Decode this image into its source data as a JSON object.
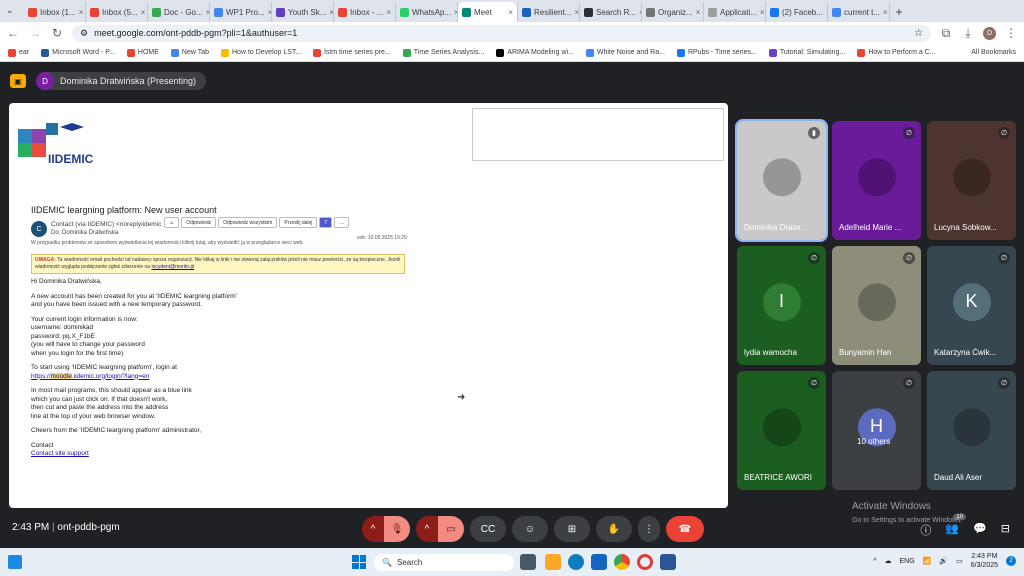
{
  "tabs": [
    {
      "label": "Inbox (1...",
      "color": "#ea4335"
    },
    {
      "label": "Inbox (5...",
      "color": "#ea4335"
    },
    {
      "label": "Doc - Go...",
      "color": "#34a853"
    },
    {
      "label": "WP1 Pro...",
      "color": "#4285f4"
    },
    {
      "label": "Youth Sk...",
      "color": "#5f3dc4"
    },
    {
      "label": "Inbox - ...",
      "color": "#ea4335"
    },
    {
      "label": "WhatsAp...",
      "color": "#25d366"
    },
    {
      "label": "Meet",
      "color": "#00897b",
      "active": true
    },
    {
      "label": "Resilient...",
      "color": "#1565c0"
    },
    {
      "label": "Search R...",
      "color": "#263238"
    },
    {
      "label": "Organiz...",
      "color": "#757575"
    },
    {
      "label": "Applicati...",
      "color": "#9e9e9e"
    },
    {
      "label": "(2) Faceb...",
      "color": "#1877f2"
    },
    {
      "label": "current t...",
      "color": "#4285f4"
    }
  ],
  "omnibox": {
    "url": "meet.google.com/ont-pddb-pgm?pli=1&authuser=1"
  },
  "bookmarks": [
    {
      "label": "ear",
      "color": "#ea4335"
    },
    {
      "label": "Microsoft Word - P...",
      "color": "#2b579a"
    },
    {
      "label": "HOME",
      "color": "#ea4335"
    },
    {
      "label": "New Tab",
      "color": "#4285f4"
    },
    {
      "label": "How to Develop LST...",
      "color": "#fbbc04"
    },
    {
      "label": "lstm time series pre...",
      "color": "#ea4335"
    },
    {
      "label": "Time Series Analysis...",
      "color": "#34a853"
    },
    {
      "label": "ARIMA Modeling wi...",
      "color": "#000000"
    },
    {
      "label": "White Noise and Ra...",
      "color": "#4285f4"
    },
    {
      "label": "RPubs - Time series...",
      "color": "#1877f2"
    },
    {
      "label": "Tutorial: Simulating...",
      "color": "#6f42c1"
    },
    {
      "label": "How to Perform a C...",
      "color": "#ea4335"
    }
  ],
  "all_bookmarks": "All Bookmarks",
  "presenter": {
    "initial": "D",
    "label": "Dominika Dratwińska (Presenting)"
  },
  "email": {
    "logo_text": "IIDEMIC",
    "subject": "IIDEMIC leargning platform: New user account",
    "sender": "Contact  (via IIDEMIC) <noreplyiidemic",
    "to": "Do:   Dominika Dratwińska",
    "date": "sob. 10.05.2025 19:29",
    "display_note": "W przypadku problemów ze sposobem wyświetlania tej wiadomości kliknij tutaj, aby wyświetlić ją w przeglądarce sieci web.",
    "actions": [
      "Odpowiedz",
      "Odpowiedz wszystkim",
      "Prześlij dalej"
    ],
    "warning_label": "UWAGA:",
    "warning": "Ta wiadomość email pochodzi od nadawcy spoza organizacji. Nie klikaj w linki i nie otwieraj załączników jeżeli nie masz pewności, że są bezpieczne. Jeżeli wiadomość wygląda podejrzanie zgłoś zdarzenie na",
    "warning_link": "incydent@merito.pl",
    "greeting": "Hi Dominika Dratwińska,",
    "p1": [
      "A new account has been created for you at 'IIDEMIC leargning platform'",
      "and you have been issued with a new temporary password."
    ],
    "p2": [
      "Your current login information is now:",
      "username: dominikad",
      "password: pq.X_F1bE",
      "(you will have to change your password",
      "when you login for the first time)"
    ],
    "p3": "To start using 'IIDEMIC leargning platform', login at",
    "link_pre": "https://",
    "link_hl": "moodle",
    "link_post": ".iidemic.org/login/?lang=en",
    "p4": [
      "In most mail programs, this should appear as a blue link",
      "which you can just click on. If that doesn't work,",
      "then cut and paste the address into the address",
      "line at the top of your web browser window."
    ],
    "p5": "Cheers from the 'IIDEMIC leargning platform' administrator,",
    "sig": "Contact",
    "support": "Contact site support"
  },
  "participants": [
    {
      "name": "Dominika Dratw...",
      "bg": "#c9c9c9",
      "speaking": true
    },
    {
      "name": "Adelheid Marie ...",
      "bg": "#6a1b9a"
    },
    {
      "name": "Lucyna Sobkow...",
      "bg": "#4e342e"
    },
    {
      "name": "lydia wamocha",
      "bg": "#1b5e20",
      "initial": "I",
      "avbg": "#2e7d32"
    },
    {
      "name": "Bunyamin Han",
      "bg": "#8d8d7a"
    },
    {
      "name": "Katarzyna Ćwik...",
      "bg": "#37474f",
      "initial": "K",
      "avbg": "#546e7a"
    },
    {
      "name": "BEATRICE AWORI",
      "bg": "#1b5e20"
    },
    {
      "name": "10 others",
      "bg": "#3c4043",
      "initial": "H",
      "avbg": "#5c6bc0"
    },
    {
      "name": "Daud Ali Aser",
      "bg": "#37474f"
    }
  ],
  "meeting": {
    "time": "2:43 PM",
    "code": "ont-pddb-pgm",
    "people_count": "10"
  },
  "watermark": {
    "title": "Activate Windows",
    "sub": "Go to Settings to activate Windows."
  },
  "taskbar": {
    "search": "Search",
    "lang": "ENG",
    "time": "2:43 PM",
    "date": "6/3/2025"
  }
}
